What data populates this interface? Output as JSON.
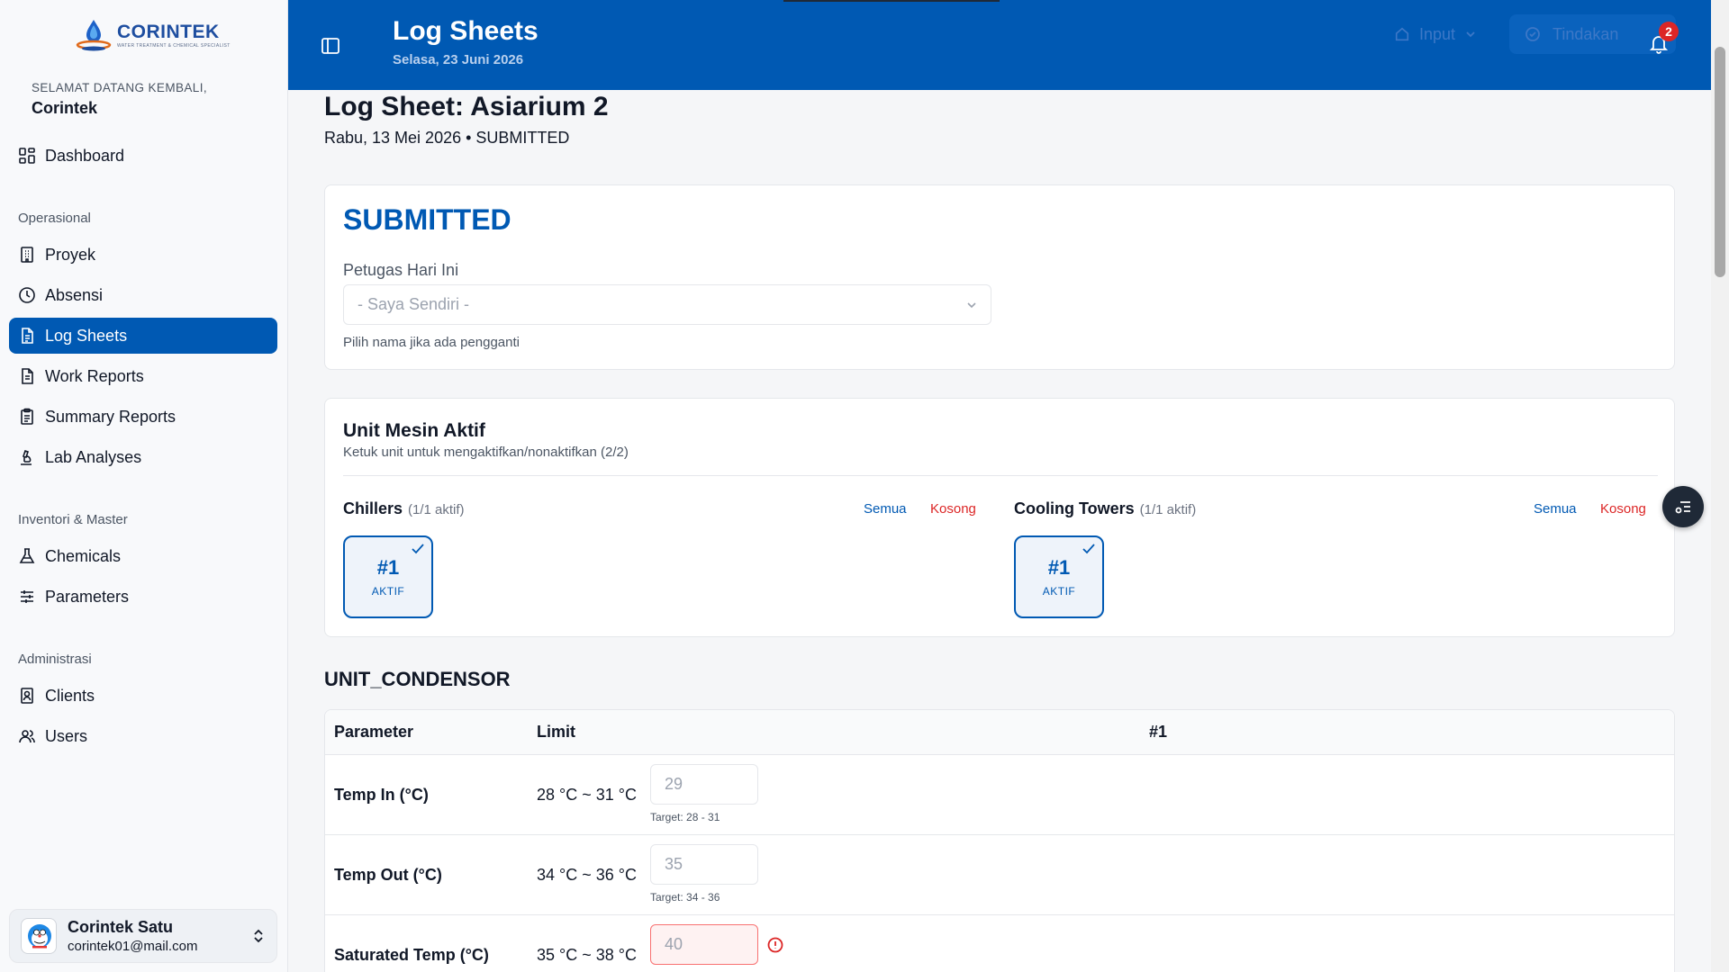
{
  "brand": {
    "name": "CORINTEK",
    "tagline": "WATER TREATMENT & CHEMICAL SPECIALIST"
  },
  "sidebar": {
    "welcome": "SELAMAT DATANG KEMBALI,",
    "user": "Corintek",
    "dashboard": "Dashboard",
    "sections": [
      "Operasional",
      "Inventori & Master",
      "Administrasi"
    ],
    "items": [
      {
        "label": "Proyek",
        "icon": "building-icon"
      },
      {
        "label": "Absensi",
        "icon": "clock-icon"
      },
      {
        "label": "Log Sheets",
        "icon": "sheet-icon",
        "active": true
      },
      {
        "label": "Work Reports",
        "icon": "file-icon"
      },
      {
        "label": "Summary Reports",
        "icon": "clipboard-icon"
      },
      {
        "label": "Lab Analyses",
        "icon": "microscope-icon"
      },
      {
        "label": "Chemicals",
        "icon": "flask-icon"
      },
      {
        "label": "Parameters",
        "icon": "sliders-icon"
      },
      {
        "label": "Clients",
        "icon": "contact-icon"
      },
      {
        "label": "Users",
        "icon": "users-icon"
      }
    ],
    "account": {
      "name": "Corintek Satu",
      "email": "corintek01@mail.com"
    }
  },
  "header": {
    "title": "Log Sheets",
    "date": "Selasa, 23 Juni 2026",
    "input_label": "Input",
    "action_label": "Tindakan",
    "notification_count": "2"
  },
  "page": {
    "title": "Log Sheet: Asiarium 2",
    "subtitle": "Rabu, 13 Mei 2026 • SUBMITTED"
  },
  "status_card": {
    "status": "SUBMITTED",
    "field_label": "Petugas Hari Ini",
    "select_value": "- Saya Sendiri -",
    "help": "Pilih nama jika ada pengganti"
  },
  "units_card": {
    "title": "Unit Mesin Aktif",
    "subtitle": "Ketuk unit untuk mengaktifkan/nonaktifkan (2/2)",
    "all_label": "Semua",
    "empty_label": "Kosong",
    "groups": [
      {
        "name": "Chillers",
        "count": "(1/1 aktif)",
        "unit": "#1",
        "state": "AKTIF"
      },
      {
        "name": "Cooling Towers",
        "count": "(1/1 aktif)",
        "unit": "#1",
        "state": "AKTIF"
      }
    ]
  },
  "condensor": {
    "title": "UNIT_CONDENSOR",
    "headers": {
      "param": "Parameter",
      "limit": "Limit",
      "unit": "#1"
    },
    "rows": [
      {
        "param": "Temp In (°C)",
        "limit": "28 °C ~ 31 °C",
        "value": "29",
        "target": "Target: 28 - 31"
      },
      {
        "param": "Temp Out (°C)",
        "limit": "34 °C ~ 36 °C",
        "value": "35",
        "target": "Target: 34 - 36"
      },
      {
        "param": "Saturated Temp (°C)",
        "limit": "35 °C ~ 38 °C",
        "value": "40",
        "target": ""
      }
    ]
  },
  "colors": {
    "primary": "#0059b3",
    "danger": "#dc2626"
  }
}
